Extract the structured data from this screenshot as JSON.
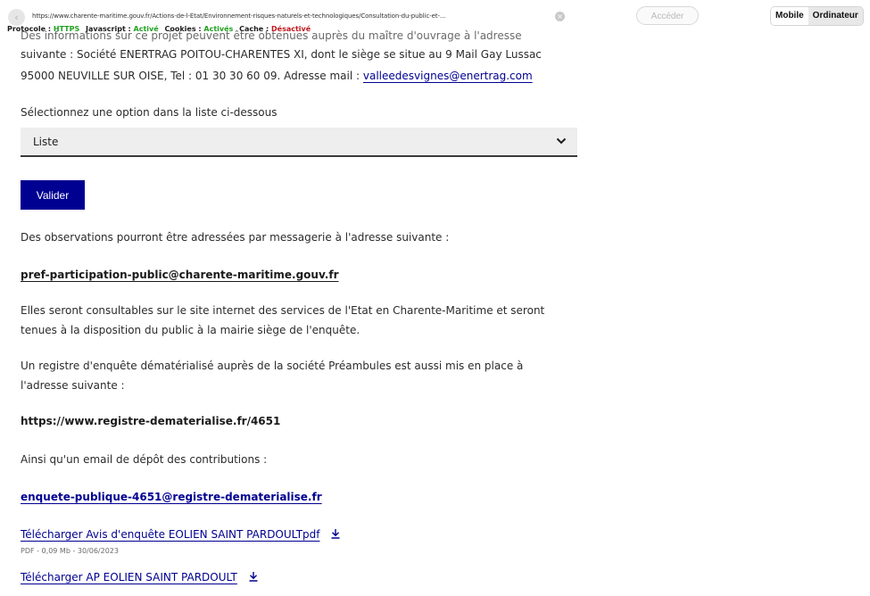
{
  "toolbar": {
    "back_icon": "chevron-left-icon",
    "url": "https://www.charente-maritime.gouv.fr/Actions-de-l-Etat/Environnement-risques-naturels-et-technologiques/Consultation-du-public-et-...",
    "clear_icon": "close-icon",
    "status": {
      "protocol_label": "Protocole :",
      "protocol_value": "HTTPS",
      "javascript_label": "Javascript :",
      "javascript_value": "Activé",
      "cookies_label": "Cookies :",
      "cookies_value": "Activés",
      "cache_label": "Cache :",
      "cache_value": "Désactivé"
    },
    "go_button": "Accéder",
    "mode_mobile": "Mobile",
    "mode_desktop": "Ordinateur"
  },
  "content": {
    "clipped_line": "Des informations sur ce projet peuvent être obtenues auprès du maître d'ouvrage à l'adresse",
    "line_2": "suivante : Société ENERTRAG POITOU-CHARENTES XI, dont le siège se situe au 9 Mail Gay Lussac",
    "line_3_text": "95000 NEUVILLE SUR OISE, Tel : 01 30 30 60 09. Adresse mail :",
    "line_3_email": "valleedesvignes@enertrag.com",
    "select_prompt": "Sélectionnez une option dans la liste ci-dessous",
    "select_value": "Liste",
    "submit_button": "Valider",
    "observations_text": "Des observations pourront être adressées par messagerie à l'adresse suivante :",
    "observations_email": "pref-participation-public@charente-maritime.gouv.fr",
    "consult_line_1": "Elles seront consultables sur le site internet des services de l'Etat en Charente-Maritime et seront",
    "consult_line_2": "tenues à la disposition du public à la mairie siège de l'enquête.",
    "registry_line_1": "Un registre d'enquête dématérialisé auprès de la société Préambules est aussi mis en place à",
    "registry_line_2": "l'adresse suivante :",
    "registry_url": "https://www.registre-dematerialise.fr/4651",
    "email_intro": "Ainsi qu'un email de dépôt des contributions :",
    "contrib_email": "enquete-publique-4651@registre-dematerialise.fr",
    "downloads": [
      {
        "label": "Télécharger Avis d'enquête EOLIEN SAINT PARDOULTpdf",
        "meta": "PDF - 0,09 Mb - 30/06/2023"
      },
      {
        "label": "Télécharger AP EOLIEN SAINT PARDOULT",
        "meta": ""
      }
    ]
  },
  "colors": {
    "link": "#000091",
    "button_bg": "#000091",
    "status_ok": "#21a021",
    "status_off": "#c0151b"
  }
}
